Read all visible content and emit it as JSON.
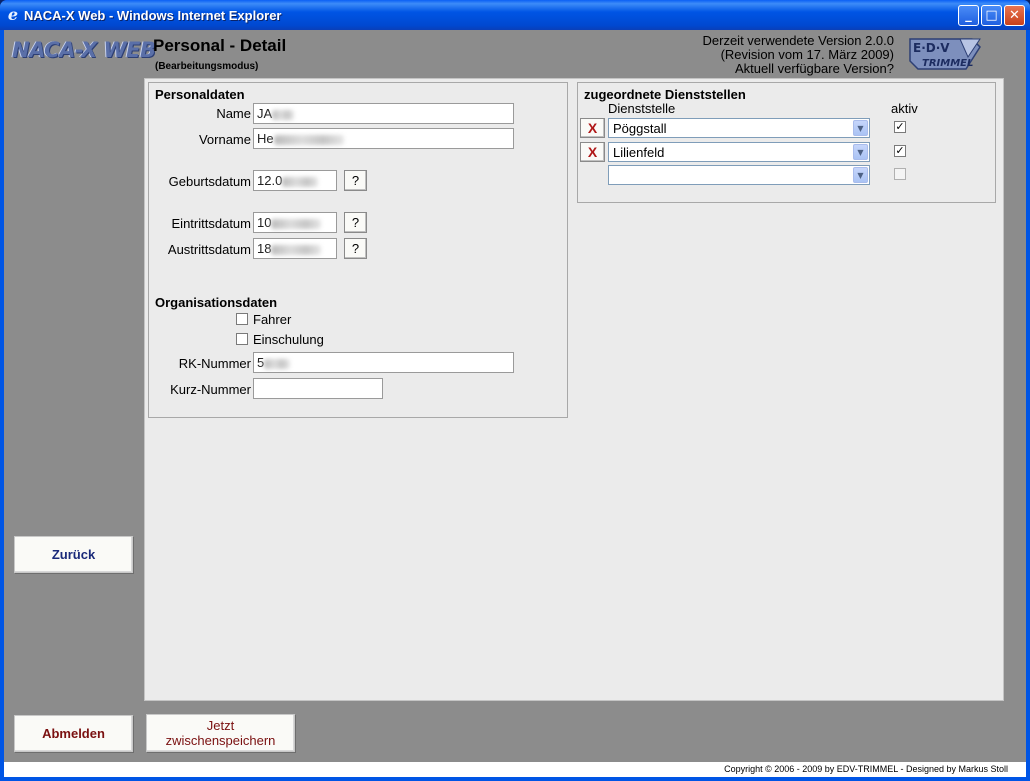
{
  "window": {
    "title": "NACA-X Web - Windows Internet Explorer"
  },
  "header": {
    "logo_text": "NACA-X WEB",
    "page_title": "Personal - Detail",
    "page_subtitle": "(Bearbeitungsmodus)",
    "version_line1": "Derzeit verwendete Version 2.0.0",
    "version_line2": "(Revision vom 17. März 2009)",
    "version_line3": "Aktuell verfügbare Version?",
    "edv_logo_top": "E·D·V",
    "edv_logo_bottom": "TRIMMEL"
  },
  "personaldaten": {
    "title": "Personaldaten",
    "name_label": "Name",
    "name_value": "JA",
    "vorname_label": "Vorname",
    "vorname_value": "He",
    "geburtsdatum_label": "Geburtsdatum",
    "geburtsdatum_value": "12.0",
    "eintrittsdatum_label": "Eintrittsdatum",
    "eintrittsdatum_value": "10",
    "austrittsdatum_label": "Austrittsdatum",
    "austrittsdatum_value": "18",
    "help_label": "?"
  },
  "organisationsdaten": {
    "title": "Organisationsdaten",
    "fahrer_label": "Fahrer",
    "fahrer_checked": false,
    "einschulung_label": "Einschulung",
    "einschulung_checked": false,
    "rk_nummer_label": "RK-Nummer",
    "rk_nummer_value": "5",
    "kurz_nummer_label": "Kurz-Nummer",
    "kurz_nummer_value": ""
  },
  "dienststellen": {
    "title": "zugeordnete Dienststellen",
    "col_dienststelle": "Dienststelle",
    "col_aktiv": "aktiv",
    "remove_label": "X",
    "rows": [
      {
        "value": "Pöggstall",
        "aktiv": true
      },
      {
        "value": "Lilienfeld",
        "aktiv": true
      },
      {
        "value": "",
        "aktiv": false
      }
    ]
  },
  "nav": {
    "back_label": "Zurück",
    "logout_label": "Abmelden",
    "save_label_line1": "Jetzt",
    "save_label_line2": "zwischenspeichern"
  },
  "footer": {
    "copyright": "Copyright © 2006 - 2009 by EDV-TRIMMEL - Designed by Markus Stoll"
  },
  "colors": {
    "titlebar": "#0055e5",
    "frame": "#8c8c8c",
    "content": "#ebebeb",
    "accent_blue": "#1a2a7a",
    "accent_red": "#7a1010"
  }
}
